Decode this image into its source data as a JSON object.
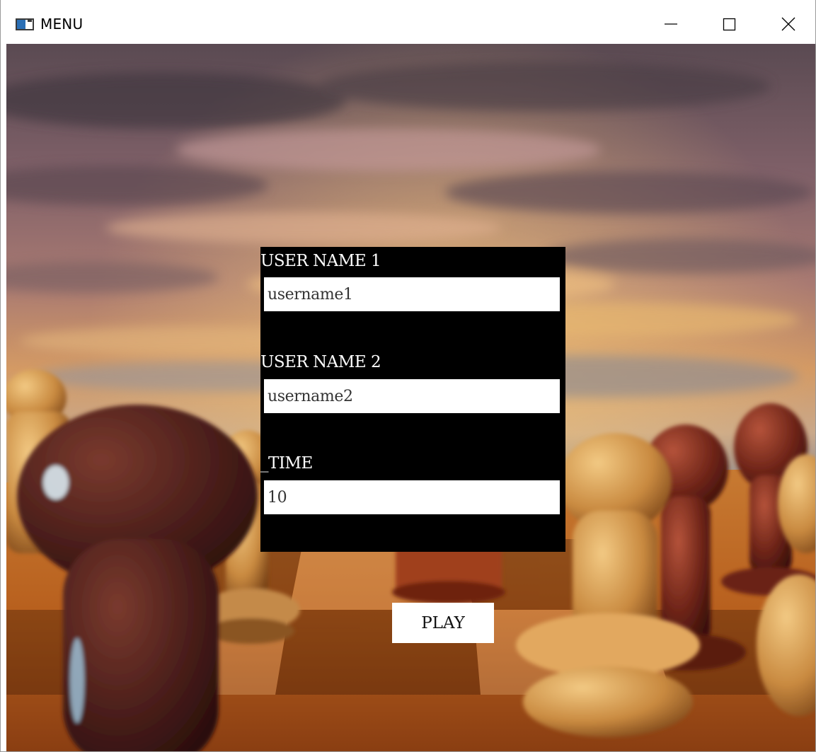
{
  "window": {
    "title": "MENU",
    "app_icon": "window-app-icon",
    "controls": {
      "minimize_icon": "minimize-icon",
      "maximize_icon": "maximize-icon",
      "close_icon": "close-icon"
    }
  },
  "form": {
    "user1": {
      "label": "USER NAME 1",
      "value": "username1"
    },
    "user2": {
      "label": "USER NAME 2",
      "value": "username2"
    },
    "time": {
      "label": "_TIME",
      "value": "10"
    }
  },
  "play_button": {
    "label": "PLAY"
  },
  "colors": {
    "panel_background": "#000000",
    "label_text": "#ffffff",
    "input_background": "#ffffff",
    "button_background": "#ffffff"
  }
}
